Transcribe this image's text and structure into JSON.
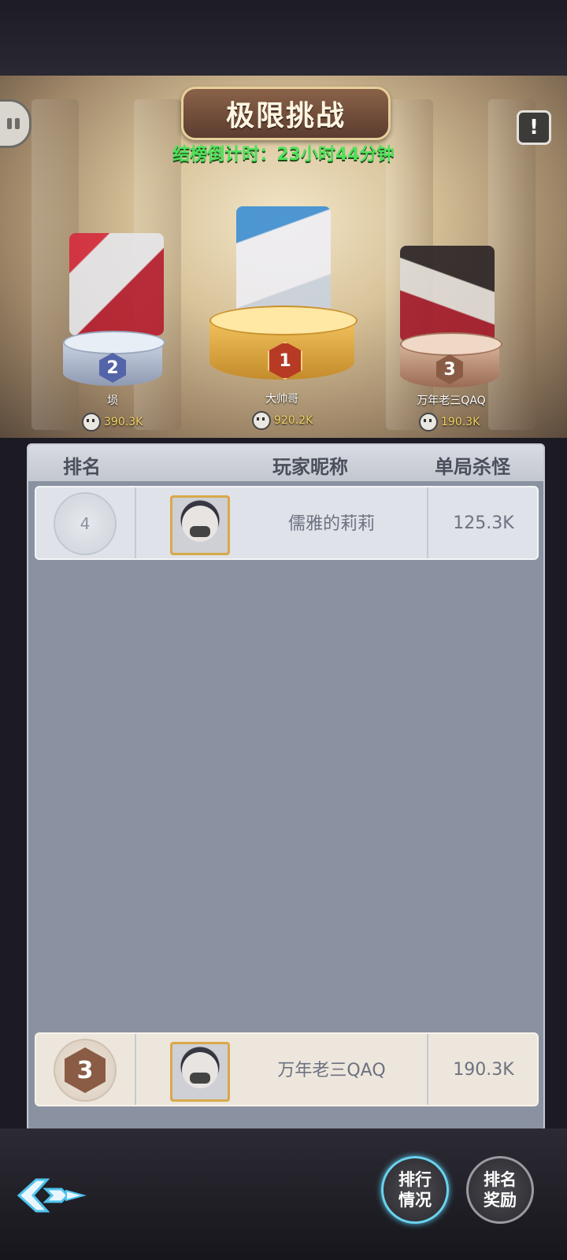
{
  "header": {
    "title": "极限挑战",
    "countdown": "结榜倒计时：23小时44分钟",
    "info_icon_text": "!"
  },
  "podium": [
    {
      "rank": "2",
      "name": "埙",
      "score": "390.3K"
    },
    {
      "rank": "1",
      "name": "大帅哥",
      "score": "920.2K"
    },
    {
      "rank": "3",
      "name": "万年老三QAQ",
      "score": "190.3K"
    }
  ],
  "table": {
    "columns": [
      "排名",
      "玩家昵称",
      "单局杀怪"
    ],
    "rows": [
      {
        "rank": "4",
        "name": "儒雅的莉莉",
        "score": "125.3K"
      }
    ]
  },
  "self_row": {
    "rank": "3",
    "name": "万年老三QAQ",
    "score": "190.3K"
  },
  "buttons": {
    "ranking_status": [
      "排行",
      "情况"
    ],
    "ranking_rewards": [
      "排名",
      "奖励"
    ]
  },
  "colors": {
    "countdown": "#4fe15a",
    "gold": "#f1c25c",
    "silver": "#c8d2e2",
    "bronze": "#d8b49a",
    "panel": "#8a92a1"
  }
}
